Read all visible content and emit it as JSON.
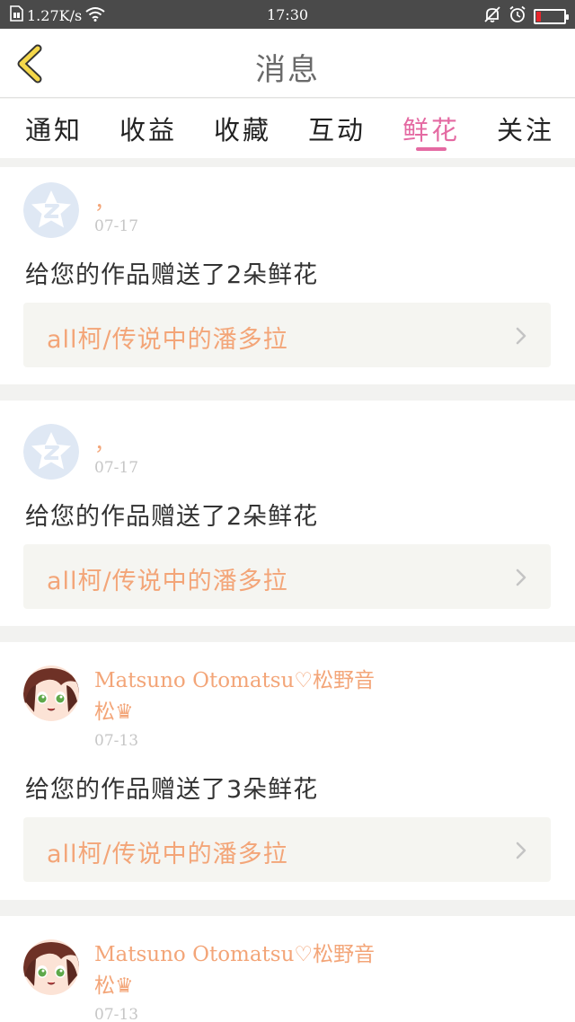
{
  "status_bar": {
    "net_speed": "1.27K/s",
    "time": "17:30",
    "battery_level": 0.15,
    "battery_color": "#e8262c"
  },
  "header": {
    "title": "消息",
    "back_icon": "chevron-left-icon",
    "back_icon_color": "#f5d84a"
  },
  "tabs": [
    {
      "label": "通知",
      "active": false
    },
    {
      "label": "收益",
      "active": false
    },
    {
      "label": "收藏",
      "active": false
    },
    {
      "label": "互动",
      "active": false
    },
    {
      "label": "鲜花",
      "active": true
    },
    {
      "label": "关注",
      "active": false
    }
  ],
  "accent_color": "#e46aa2",
  "name_color": "#f3a578",
  "messages": [
    {
      "sender": "，",
      "avatar": "default-z-avatar",
      "date": "07-17",
      "text": "给您的作品赠送了2朵鲜花",
      "work_title": "all柯/传说中的潘多拉"
    },
    {
      "sender": "，",
      "avatar": "default-z-avatar",
      "date": "07-17",
      "text": "给您的作品赠送了2朵鲜花",
      "work_title": "all柯/传说中的潘多拉"
    },
    {
      "sender": "Matsuno Otomatsu♡松野音松♛",
      "avatar": "anime-girl-avatar",
      "date": "07-13",
      "text": "给您的作品赠送了3朵鲜花",
      "work_title": "all柯/传说中的潘多拉"
    },
    {
      "sender": "Matsuno Otomatsu♡松野音松♛",
      "avatar": "anime-girl-avatar",
      "date": "07-13",
      "text": "",
      "work_title": ""
    }
  ]
}
